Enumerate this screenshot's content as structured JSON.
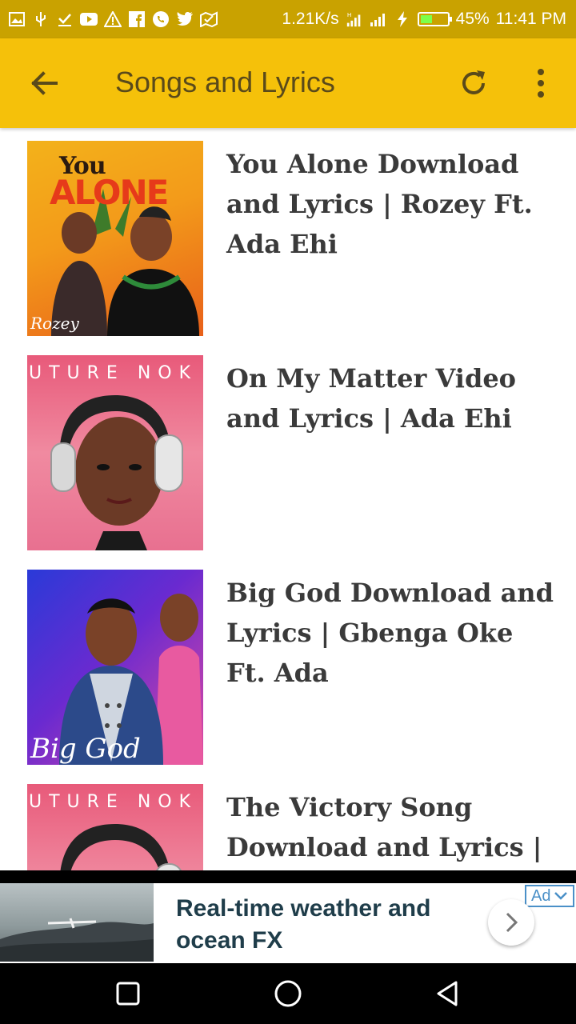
{
  "status": {
    "speed": "1.21K/s",
    "battery": "45%",
    "time": "11:41 PM",
    "battery_level": 0.45
  },
  "appbar": {
    "title": "Songs and Lyrics",
    "back_icon": "arrow-back-icon",
    "refresh_icon": "refresh-icon",
    "more_icon": "more-vert-icon"
  },
  "list": {
    "items": [
      {
        "title": "You Alone Download and Lyrics | Rozey Ft. Ada Ehi",
        "thumb_text": "You ALONE",
        "thumb_sub": "Rozey"
      },
      {
        "title": "On My Matter Video and Lyrics | Ada Ehi",
        "thumb_text": "UTURE NOK"
      },
      {
        "title": "Big God Download and Lyrics | Gbenga Oke Ft. Ada",
        "thumb_text": "Big God"
      },
      {
        "title": "The Victory Song Download and Lyrics |",
        "thumb_text": "UTURE NOK"
      }
    ]
  },
  "ad": {
    "text": "Real-time weather and ocean FX",
    "badge": "Ad"
  },
  "colors": {
    "statusbar": "#c9a200",
    "appbar": "#f5c10a",
    "title_text": "#5a4a1a"
  }
}
